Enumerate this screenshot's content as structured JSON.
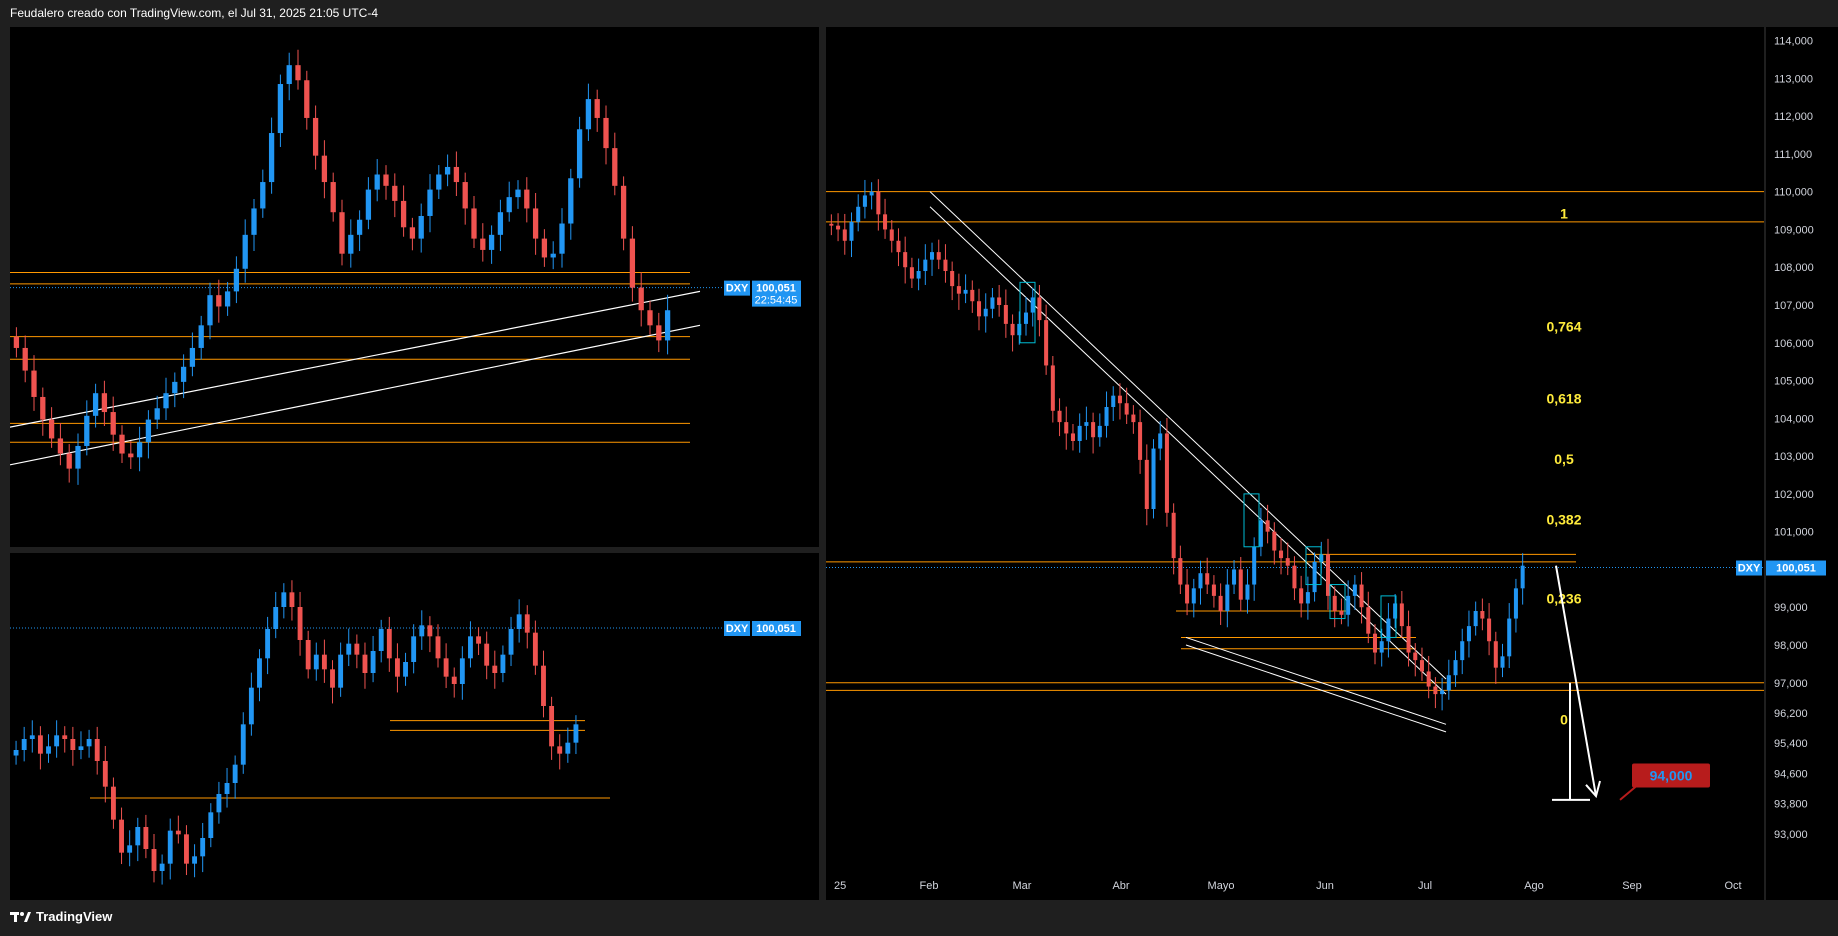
{
  "header": {
    "caption": "Feudalero creado con TradingView.com, el Jul 31, 2025 21:05 UTC-4"
  },
  "footer": {
    "brand": "TradingView",
    "logo": "tv-logo-icon"
  },
  "colors": {
    "up": "#2196f3",
    "down": "#ef5350",
    "hline": "#ff9800",
    "trend": "#ffffff",
    "fib_text": "#ffeb3b",
    "tag_bg": "#2196f3",
    "target_box_bg": "#b71c1c",
    "target_box_fg": "#2196f3"
  },
  "charts": {
    "top_left": {
      "symbol_tag": "DXY",
      "price_tag": "100,051",
      "countdown": "22:54:45"
    },
    "bottom_left": {
      "symbol_tag": "DXY",
      "price_tag": "100,051"
    },
    "right": {
      "symbol_tag": "DXY",
      "price_tag": "100,051",
      "target_box": "94,000"
    }
  },
  "chart_data": [
    {
      "type": "candlestick",
      "name": "top_left",
      "y_axis_shown": false,
      "close_series": [
        105.9,
        105.3,
        104.6,
        104.0,
        103.5,
        103.1,
        102.7,
        103.3,
        104.1,
        104.7,
        104.2,
        103.6,
        103.1,
        103.0,
        103.4,
        104.0,
        104.3,
        104.7,
        105.0,
        105.4,
        105.9,
        106.5,
        107.3,
        107.0,
        107.4,
        108.0,
        108.9,
        109.6,
        110.3,
        111.6,
        112.9,
        113.4,
        113.0,
        112.0,
        111.0,
        110.3,
        109.5,
        108.4,
        108.9,
        109.3,
        110.1,
        110.5,
        110.2,
        109.8,
        109.1,
        108.8,
        109.4,
        110.1,
        110.5,
        110.7,
        110.3,
        109.6,
        108.8,
        108.5,
        108.9,
        109.5,
        109.9,
        110.1,
        109.6,
        108.8,
        108.3,
        108.4,
        109.2,
        110.4,
        111.7,
        112.5,
        112.0,
        111.2,
        110.2,
        108.8,
        107.5,
        106.9,
        106.5,
        106.1,
        106.9
      ],
      "hlines": [
        107.9,
        107.6,
        106.2,
        105.6,
        103.9,
        103.4
      ],
      "trendlines": "two rising white lines from the left lows through the current price area",
      "last_price": 100.051
    },
    {
      "type": "candlestick",
      "name": "bottom_left",
      "y_axis_shown": false,
      "close_series": [
        100.5,
        100.8,
        100.9,
        100.4,
        100.6,
        100.9,
        100.8,
        100.5,
        100.6,
        100.8,
        100.2,
        99.5,
        98.6,
        97.7,
        97.9,
        98.4,
        97.8,
        97.2,
        97.4,
        98.3,
        98.2,
        97.4,
        97.6,
        98.1,
        98.8,
        99.3,
        99.6,
        100.1,
        101.2,
        102.2,
        103.0,
        103.8,
        104.4,
        104.8,
        104.4,
        103.5,
        102.7,
        103.1,
        102.7,
        102.2,
        103.1,
        103.4,
        103.1,
        102.6,
        103.2,
        103.8,
        103.0,
        102.5,
        102.9,
        103.6,
        103.9,
        103.6,
        103.0,
        102.5,
        102.3,
        103.0,
        103.6,
        103.4,
        102.8,
        102.6,
        103.1,
        103.8,
        104.2,
        103.7,
        102.8,
        101.7,
        100.6,
        100.4,
        100.7,
        101.2
      ],
      "hlines": [
        101.3,
        101.2,
        100.5
      ],
      "last_price": 100.051
    },
    {
      "type": "candlestick",
      "name": "right",
      "title": "",
      "x_axis_labels": [
        "25",
        "Feb",
        "Mar",
        "Abr",
        "Mayo",
        "Jun",
        "Jul",
        "Ago",
        "Sep",
        "Oct"
      ],
      "y_axis_labels": [
        "114,000",
        "113,000",
        "112,000",
        "111,000",
        "110,000",
        "109,000",
        "108,000",
        "107,000",
        "106,000",
        "105,000",
        "104,000",
        "103,000",
        "102,000",
        "101,000",
        "100,000",
        "99,000",
        "98,000",
        "97,000",
        "96,200",
        "95,400",
        "94,600",
        "93,800",
        "93,000"
      ],
      "ylim": [
        92.6,
        114.2
      ],
      "close_series": [
        109.1,
        109.0,
        108.7,
        109.2,
        109.6,
        109.9,
        110.0,
        109.4,
        109.0,
        108.7,
        108.4,
        108.0,
        107.7,
        107.9,
        108.2,
        108.4,
        108.2,
        107.9,
        107.5,
        107.3,
        107.4,
        107.1,
        106.7,
        106.9,
        107.2,
        107.0,
        106.5,
        106.2,
        106.5,
        106.8,
        107.2,
        106.6,
        105.4,
        104.2,
        103.9,
        103.6,
        103.4,
        103.8,
        103.9,
        103.5,
        103.8,
        104.3,
        104.6,
        104.4,
        104.1,
        103.9,
        102.9,
        101.6,
        103.2,
        103.6,
        101.5,
        100.3,
        99.6,
        99.1,
        99.5,
        99.9,
        99.6,
        99.3,
        98.9,
        99.6,
        100.0,
        99.2,
        99.6,
        100.6,
        101.3,
        101.0,
        100.5,
        100.3,
        100.1,
        99.5,
        99.1,
        99.4,
        100.2,
        100.4,
        99.3,
        98.9,
        98.8,
        99.3,
        99.6,
        99.0,
        98.3,
        97.8,
        98.1,
        98.7,
        99.1,
        98.5,
        97.8,
        97.6,
        97.3,
        96.9,
        96.7,
        96.8,
        97.2,
        97.6,
        98.1,
        98.5,
        98.9,
        98.7,
        98.1,
        97.4,
        97.7,
        98.7,
        99.5,
        100.1
      ],
      "hlines": [
        110.0,
        109.2,
        100.4,
        100.2,
        98.9,
        98.2,
        97.9,
        97.0,
        96.8
      ],
      "fib_levels": [
        {
          "label": "1",
          "value": 109.4
        },
        {
          "label": "0,764",
          "value": 106.4
        },
        {
          "label": "0,618",
          "value": 104.5
        },
        {
          "label": "0,5",
          "value": 102.9
        },
        {
          "label": "0,382",
          "value": 101.3
        },
        {
          "label": "0,236",
          "value": 99.2
        },
        {
          "label": "0",
          "value": 96.0
        }
      ],
      "projection_target": 94.0,
      "last_price": 100.051
    }
  ]
}
